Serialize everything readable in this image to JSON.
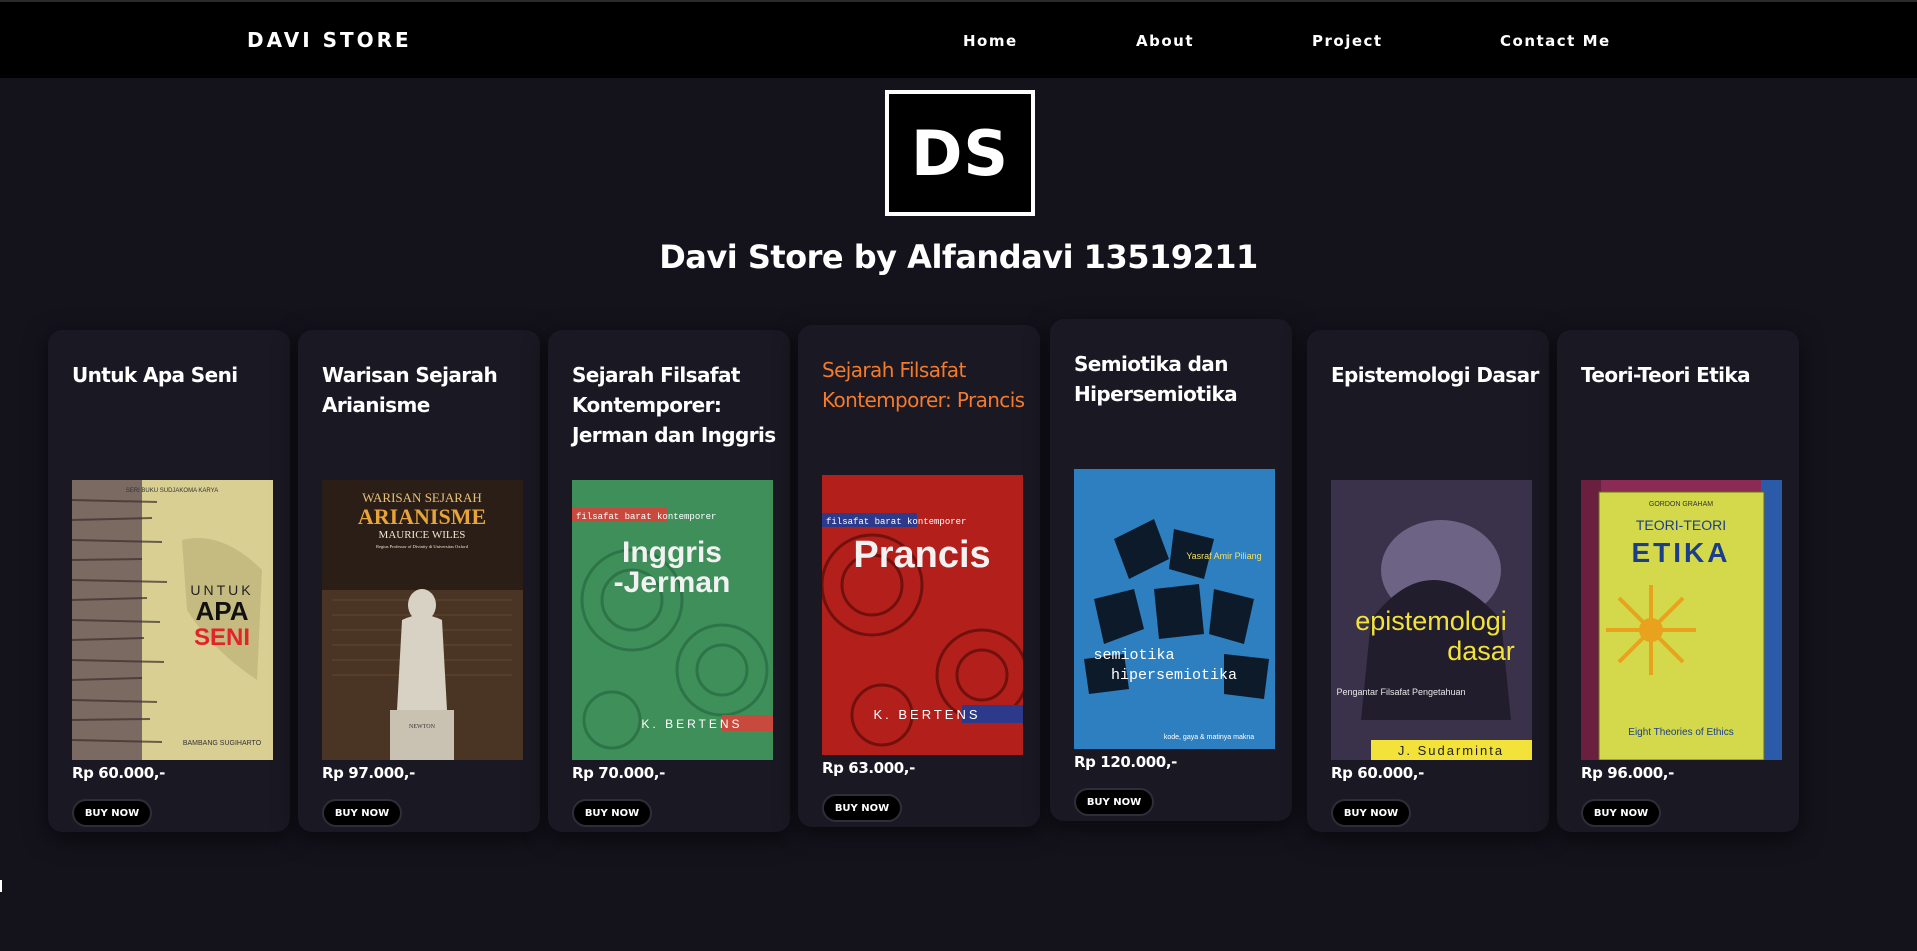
{
  "nav": {
    "brand": "DAVI STORE",
    "links": [
      "Home",
      "About",
      "Project",
      "Contact Me"
    ]
  },
  "hero": {
    "logo_text": "DS",
    "title": "Davi Store by Alfandavi 13519211"
  },
  "products": [
    {
      "title": "Untuk Apa Seni",
      "price": "Rp 60.000,-",
      "button": "BUY NOW",
      "cover": {
        "top_text": "SERI BUKU SUDJAKOMA KARYA",
        "line1": "UNTUK",
        "line2": "APA",
        "line3": "SENI",
        "author": "BAMBANG SUGIHARTO",
        "bg": "#d9cf93"
      }
    },
    {
      "title": "Warisan Sejarah Arianisme",
      "price": "Rp 97.000,-",
      "button": "BUY NOW",
      "cover": {
        "top_text": "WARISAN SEJARAH",
        "line1": "ARIANISME",
        "line2": "MAURICE WILES",
        "line3": "Regius Professor of Divinity di Universitas Oxford",
        "author": "NEWTON",
        "bg": "#2a1e16"
      }
    },
    {
      "title": "Sejarah Filsafat Kontemporer: Jerman dan Inggris",
      "price": "Rp 70.000,-",
      "button": "BUY NOW",
      "cover": {
        "top_text": "filsafat barat kontemporer",
        "line1": "Inggris",
        "line2": "-Jerman",
        "line3": "",
        "author": "K. BERTENS",
        "bg": "#3f8f5a"
      }
    },
    {
      "title": "Sejarah Filsafat Kontemporer: Prancis",
      "price": "Rp 63.000,-",
      "button": "BUY NOW",
      "cover": {
        "top_text": "filsafat barat kontemporer",
        "line1": "Prancis",
        "line2": "",
        "line3": "",
        "author": "K. BERTENS",
        "bg": "#b3201b"
      }
    },
    {
      "title": "Semiotika dan Hipersemiotika",
      "price": "Rp 120.000,-",
      "button": "BUY NOW",
      "cover": {
        "top_text": "Yasraf Amir Piliang",
        "line1": "semiotika",
        "line2": "hipersemiotika",
        "line3": "kode, gaya & matinya makna",
        "author": "",
        "bg": "#2e7fc0"
      }
    },
    {
      "title": "Epistemologi Dasar",
      "price": "Rp 60.000,-",
      "button": "BUY NOW",
      "cover": {
        "top_text": "",
        "line1": "epistemologi",
        "line2": "dasar",
        "line3": "Pengantar Filsafat Pengetahuan",
        "author": "J. Sudarminta",
        "bg": "#3a324a"
      }
    },
    {
      "title": "Teori-Teori Etika",
      "price": "Rp 96.000,-",
      "button": "BUY NOW",
      "cover": {
        "top_text": "GORDON GRAHAM",
        "line1": "TEORI-TEORI",
        "line2": "ETIKA",
        "line3": "Eight Theories of Ethics",
        "author": "",
        "bg": "#d3d94a"
      }
    }
  ],
  "colors": {
    "page_bg": "#14121b",
    "nav_bg": "#000000",
    "card_bg": "#1a1822",
    "active_title": "#f47a2c"
  }
}
